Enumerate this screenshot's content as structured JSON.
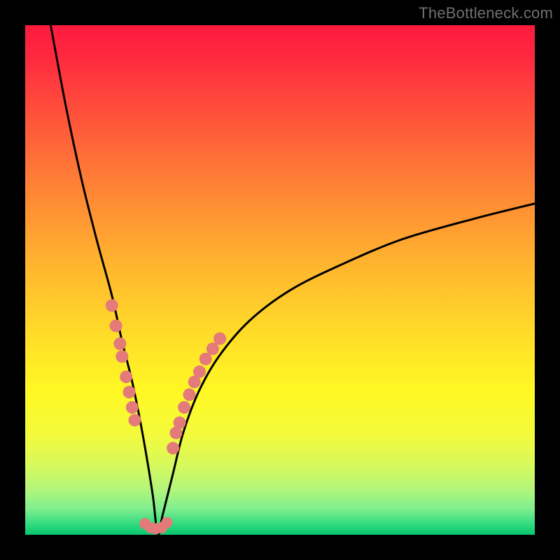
{
  "watermark": "TheBottleneck.com",
  "colors": {
    "frame": "#000000",
    "curve": "#000000",
    "dot_fill": "#e47a7a",
    "dot_stroke": "#d06666"
  },
  "chart_data": {
    "type": "line",
    "title": "",
    "xlabel": "",
    "ylabel": "",
    "xlim": [
      0,
      100
    ],
    "ylim": [
      0,
      100
    ],
    "note": "V-shaped bottleneck curve. Minimum (~0) near x≈26. Left branch rises steeply to ~100 at x≈5; right branch rises more gradually to ~65 at x≈100. Pink dots cluster along lower portions of both branches and along the trough.",
    "series": [
      {
        "name": "curve",
        "x": [
          5,
          8,
          11,
          14,
          17,
          19,
          21,
          23,
          25,
          26,
          27,
          29,
          31,
          34,
          38,
          44,
          52,
          62,
          74,
          88,
          100
        ],
        "y": [
          100,
          84,
          70,
          58,
          47,
          38,
          30,
          20,
          8,
          0,
          4,
          12,
          20,
          28,
          35,
          42,
          48,
          53,
          58,
          62,
          65
        ]
      },
      {
        "name": "dots-left-branch",
        "x": [
          17.0,
          17.8,
          18.6,
          19.0,
          19.8,
          20.4,
          21.0,
          21.5
        ],
        "y": [
          45.0,
          41.0,
          37.5,
          35.0,
          31.0,
          28.0,
          25.0,
          22.5
        ]
      },
      {
        "name": "dots-trough",
        "x": [
          23.5,
          24.6,
          25.7,
          26.8,
          27.8
        ],
        "y": [
          2.2,
          1.4,
          1.2,
          1.4,
          2.4
        ]
      },
      {
        "name": "dots-right-branch",
        "x": [
          29.0,
          29.6,
          30.3,
          31.2,
          32.2,
          33.2,
          34.2,
          35.4,
          36.8,
          38.2
        ],
        "y": [
          17.0,
          20.0,
          22.0,
          25.0,
          27.5,
          30.0,
          32.0,
          34.5,
          36.5,
          38.5
        ]
      }
    ]
  }
}
